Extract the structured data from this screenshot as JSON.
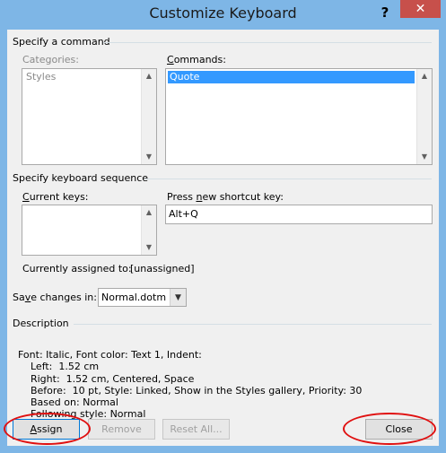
{
  "window": {
    "title": "Customize Keyboard",
    "help_glyph": "?",
    "close_glyph": "✕"
  },
  "command_group": {
    "title": "Specify a command",
    "categories_label": "Categories:",
    "categories": [
      "Styles"
    ],
    "commands_label": "Commands:",
    "commands": [
      "Quote"
    ]
  },
  "keyboard_group": {
    "title": "Specify keyboard sequence",
    "current_keys_label": "Current keys:",
    "new_key_label": "Press new shortcut key:",
    "new_key_value": "Alt+Q",
    "assigned_label": "Currently assigned to:",
    "assigned_value": "[unassigned]"
  },
  "save": {
    "label": "Save changes in:",
    "value": "Normal.dotm"
  },
  "description": {
    "title": "Description",
    "lines": [
      "Font: Italic, Font color: Text 1, Indent:",
      "    Left:  1.52 cm",
      "    Right:  1.52 cm, Centered, Space",
      "    Before:  10 pt, Style: Linked, Show in the Styles gallery, Priority: 30",
      "    Based on: Normal",
      "    Following style: Normal"
    ]
  },
  "buttons": {
    "assign": "Assign",
    "remove": "Remove",
    "reset_all": "Reset All...",
    "close": "Close"
  },
  "colors": {
    "frame": "#7eb6e6",
    "selection": "#3399ff",
    "highlight_circle": "#e01010",
    "close_button": "#c7504b"
  }
}
